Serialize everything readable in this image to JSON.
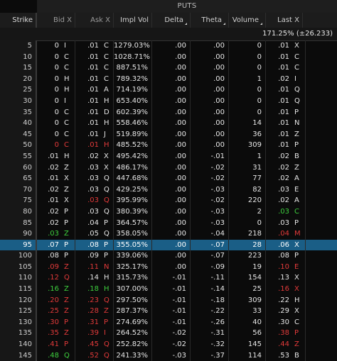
{
  "header": {
    "puts_label": "PUTS",
    "columns": {
      "strike": "Strike",
      "bid_x": "Bid X",
      "ask_x": "Ask X",
      "impl_vol": "Impl Vol",
      "delta": "Delta",
      "theta": "Theta",
      "volume": "Volume",
      "last_x": "Last X"
    }
  },
  "iv_summary": "171.25% (±26.233)",
  "colors": {
    "green": "#3ecf3e",
    "red": "#e23a3a",
    "white": "#e6e6e6",
    "selected_row": "#1a5e86"
  },
  "selected_strike": "95",
  "rows": [
    {
      "strike": "5",
      "bid": "0",
      "bid_x": "I",
      "ask": ".01",
      "ask_x": "C",
      "iv": "1279.03%",
      "delta": ".00",
      "theta": ".00",
      "volume": "0",
      "last": ".01",
      "last_x": "X",
      "bid_c": "w",
      "ask_c": "w",
      "last_c": "w"
    },
    {
      "strike": "10",
      "bid": "0",
      "bid_x": "C",
      "ask": ".01",
      "ask_x": "C",
      "iv": "1028.71%",
      "delta": ".00",
      "theta": ".00",
      "volume": "0",
      "last": ".01",
      "last_x": "C",
      "bid_c": "w",
      "ask_c": "w",
      "last_c": "w"
    },
    {
      "strike": "15",
      "bid": "0",
      "bid_x": "C",
      "ask": ".01",
      "ask_x": "C",
      "iv": "887.51%",
      "delta": ".00",
      "theta": ".00",
      "volume": "0",
      "last": ".01",
      "last_x": "C",
      "bid_c": "w",
      "ask_c": "w",
      "last_c": "w"
    },
    {
      "strike": "20",
      "bid": "0",
      "bid_x": "H",
      "ask": ".01",
      "ask_x": "C",
      "iv": "789.32%",
      "delta": ".00",
      "theta": ".00",
      "volume": "1",
      "last": ".02",
      "last_x": "I",
      "bid_c": "w",
      "ask_c": "w",
      "last_c": "w"
    },
    {
      "strike": "25",
      "bid": "0",
      "bid_x": "H",
      "ask": ".01",
      "ask_x": "A",
      "iv": "714.19%",
      "delta": ".00",
      "theta": ".00",
      "volume": "0",
      "last": ".01",
      "last_x": "Q",
      "bid_c": "w",
      "ask_c": "w",
      "last_c": "w"
    },
    {
      "strike": "30",
      "bid": "0",
      "bid_x": "I",
      "ask": ".01",
      "ask_x": "H",
      "iv": "653.40%",
      "delta": ".00",
      "theta": ".00",
      "volume": "0",
      "last": ".01",
      "last_x": "Q",
      "bid_c": "w",
      "ask_c": "w",
      "last_c": "w"
    },
    {
      "strike": "35",
      "bid": "0",
      "bid_x": "C",
      "ask": ".01",
      "ask_x": "D",
      "iv": "602.39%",
      "delta": ".00",
      "theta": ".00",
      "volume": "0",
      "last": ".01",
      "last_x": "P",
      "bid_c": "w",
      "ask_c": "w",
      "last_c": "w"
    },
    {
      "strike": "40",
      "bid": "0",
      "bid_x": "C",
      "ask": ".01",
      "ask_x": "H",
      "iv": "558.46%",
      "delta": ".00",
      "theta": ".00",
      "volume": "14",
      "last": ".01",
      "last_x": "N",
      "bid_c": "w",
      "ask_c": "w",
      "last_c": "w"
    },
    {
      "strike": "45",
      "bid": "0",
      "bid_x": "C",
      "ask": ".01",
      "ask_x": "J",
      "iv": "519.89%",
      "delta": ".00",
      "theta": ".00",
      "volume": "36",
      "last": ".01",
      "last_x": "Z",
      "bid_c": "w",
      "ask_c": "w",
      "last_c": "w"
    },
    {
      "strike": "50",
      "bid": "0",
      "bid_x": "C",
      "ask": ".01",
      "ask_x": "H",
      "iv": "485.52%",
      "delta": ".00",
      "theta": ".00",
      "volume": "309",
      "last": ".01",
      "last_x": "P",
      "bid_c": "r",
      "ask_c": "r",
      "last_c": "w"
    },
    {
      "strike": "55",
      "bid": ".01",
      "bid_x": "H",
      "ask": ".02",
      "ask_x": "X",
      "iv": "495.42%",
      "delta": ".00",
      "theta": "-.01",
      "volume": "1",
      "last": ".02",
      "last_x": "B",
      "bid_c": "w",
      "ask_c": "w",
      "last_c": "w"
    },
    {
      "strike": "60",
      "bid": ".02",
      "bid_x": "Z",
      "ask": ".03",
      "ask_x": "X",
      "iv": "486.17%",
      "delta": ".00",
      "theta": "-.02",
      "volume": "31",
      "last": ".02",
      "last_x": "Z",
      "bid_c": "w",
      "ask_c": "w",
      "last_c": "w"
    },
    {
      "strike": "65",
      "bid": ".01",
      "bid_x": "X",
      "ask": ".03",
      "ask_x": "Q",
      "iv": "447.68%",
      "delta": ".00",
      "theta": "-.02",
      "volume": "77",
      "last": ".02",
      "last_x": "A",
      "bid_c": "w",
      "ask_c": "w",
      "last_c": "w"
    },
    {
      "strike": "70",
      "bid": ".02",
      "bid_x": "Z",
      "ask": ".03",
      "ask_x": "Q",
      "iv": "429.25%",
      "delta": ".00",
      "theta": "-.03",
      "volume": "82",
      "last": ".03",
      "last_x": "E",
      "bid_c": "w",
      "ask_c": "w",
      "last_c": "w"
    },
    {
      "strike": "75",
      "bid": ".01",
      "bid_x": "X",
      "ask": ".03",
      "ask_x": "Q",
      "iv": "395.99%",
      "delta": ".00",
      "theta": "-.02",
      "volume": "220",
      "last": ".02",
      "last_x": "A",
      "bid_c": "w",
      "ask_c": "r",
      "last_c": "w"
    },
    {
      "strike": "80",
      "bid": ".02",
      "bid_x": "P",
      "ask": ".03",
      "ask_x": "Q",
      "iv": "380.39%",
      "delta": ".00",
      "theta": "-.03",
      "volume": "2",
      "last": ".03",
      "last_x": "C",
      "bid_c": "w",
      "ask_c": "w",
      "last_c": "g"
    },
    {
      "strike": "85",
      "bid": ".02",
      "bid_x": "P",
      "ask": ".04",
      "ask_x": "P",
      "iv": "364.57%",
      "delta": ".00",
      "theta": "-.03",
      "volume": "0",
      "last": ".03",
      "last_x": "P",
      "bid_c": "w",
      "ask_c": "w",
      "last_c": "w"
    },
    {
      "strike": "90",
      "bid": ".03",
      "bid_x": "Z",
      "ask": ".05",
      "ask_x": "Q",
      "iv": "358.05%",
      "delta": ".00",
      "theta": "-.04",
      "volume": "218",
      "last": ".04",
      "last_x": "M",
      "bid_c": "g",
      "ask_c": "w",
      "last_c": "r"
    },
    {
      "strike": "95",
      "bid": ".07",
      "bid_x": "P",
      "ask": ".08",
      "ask_x": "P",
      "iv": "355.05%",
      "delta": ".00",
      "theta": "-.07",
      "volume": "28",
      "last": ".06",
      "last_x": "X",
      "bid_c": "w",
      "ask_c": "w",
      "last_c": "w"
    },
    {
      "strike": "100",
      "bid": ".08",
      "bid_x": "P",
      "ask": ".09",
      "ask_x": "P",
      "iv": "339.06%",
      "delta": ".00",
      "theta": "-.07",
      "volume": "223",
      "last": ".08",
      "last_x": "P",
      "bid_c": "w",
      "ask_c": "w",
      "last_c": "w"
    },
    {
      "strike": "105",
      "bid": ".09",
      "bid_x": "Z",
      "ask": ".11",
      "ask_x": "N",
      "iv": "325.17%",
      "delta": ".00",
      "theta": "-.09",
      "volume": "19",
      "last": ".10",
      "last_x": "E",
      "bid_c": "r",
      "ask_c": "r",
      "last_c": "r"
    },
    {
      "strike": "110",
      "bid": ".12",
      "bid_x": "Q",
      "ask": ".14",
      "ask_x": "H",
      "iv": "315.73%",
      "delta": "-.01",
      "theta": "-.11",
      "volume": "154",
      "last": ".13",
      "last_x": "X",
      "bid_c": "r",
      "ask_c": "w",
      "last_c": "w"
    },
    {
      "strike": "115",
      "bid": ".16",
      "bid_x": "Z",
      "ask": ".18",
      "ask_x": "H",
      "iv": "307.00%",
      "delta": "-.01",
      "theta": "-.14",
      "volume": "25",
      "last": ".16",
      "last_x": "X",
      "bid_c": "g",
      "ask_c": "g",
      "last_c": "r"
    },
    {
      "strike": "120",
      "bid": ".20",
      "bid_x": "Z",
      "ask": ".23",
      "ask_x": "Q",
      "iv": "297.50%",
      "delta": "-.01",
      "theta": "-.18",
      "volume": "309",
      "last": ".22",
      "last_x": "H",
      "bid_c": "r",
      "ask_c": "r",
      "last_c": "w"
    },
    {
      "strike": "125",
      "bid": ".25",
      "bid_x": "Z",
      "ask": ".28",
      "ask_x": "Z",
      "iv": "287.37%",
      "delta": "-.01",
      "theta": "-.22",
      "volume": "33",
      "last": ".29",
      "last_x": "X",
      "bid_c": "r",
      "ask_c": "r",
      "last_c": "w"
    },
    {
      "strike": "130",
      "bid": ".30",
      "bid_x": "P",
      "ask": ".31",
      "ask_x": "P",
      "iv": "274.69%",
      "delta": "-.01",
      "theta": "-.26",
      "volume": "40",
      "last": ".30",
      "last_x": "C",
      "bid_c": "r",
      "ask_c": "r",
      "last_c": "w"
    },
    {
      "strike": "135",
      "bid": ".35",
      "bid_x": "Z",
      "ask": ".39",
      "ask_x": "I",
      "iv": "264.52%",
      "delta": "-.02",
      "theta": "-.31",
      "volume": "56",
      "last": ".38",
      "last_x": "P",
      "bid_c": "r",
      "ask_c": "r",
      "last_c": "r"
    },
    {
      "strike": "140",
      "bid": ".41",
      "bid_x": "P",
      "ask": ".45",
      "ask_x": "Q",
      "iv": "252.82%",
      "delta": "-.02",
      "theta": "-.32",
      "volume": "145",
      "last": ".44",
      "last_x": "Z",
      "bid_c": "r",
      "ask_c": "r",
      "last_c": "r"
    },
    {
      "strike": "145",
      "bid": ".48",
      "bid_x": "Q",
      "ask": ".52",
      "ask_x": "Q",
      "iv": "241.33%",
      "delta": "-.03",
      "theta": "-.37",
      "volume": "114",
      "last": ".53",
      "last_x": "B",
      "bid_c": "g",
      "ask_c": "r",
      "last_c": "w"
    }
  ]
}
